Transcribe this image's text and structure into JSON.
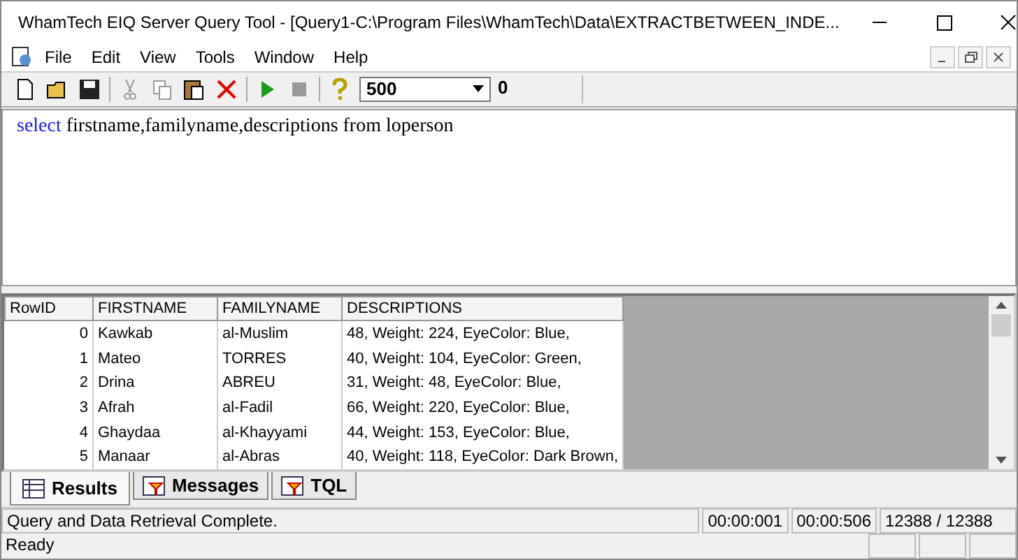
{
  "window": {
    "title": "WhamTech EIQ Server Query Tool - [Query1-C:\\Program Files\\WhamTech\\Data\\EXTRACTBETWEEN_INDE..."
  },
  "menu": [
    "File",
    "Edit",
    "View",
    "Tools",
    "Window",
    "Help"
  ],
  "toolbar": {
    "row_limit": "500",
    "count": "0"
  },
  "query": {
    "keyword": "select",
    "text": "firstname,familyname,descriptions from loperson"
  },
  "table": {
    "columns": [
      "RowID",
      "FIRSTNAME",
      "FAMILYNAME",
      "DESCRIPTIONS"
    ],
    "rows": [
      [
        "0",
        "Kawkab",
        "al-Muslim",
        "48, Weight: 224, EyeColor: Blue,"
      ],
      [
        "1",
        "Mateo",
        "TORRES",
        "40, Weight: 104, EyeColor: Green,"
      ],
      [
        "2",
        "Drina",
        "ABREU",
        "31, Weight: 48, EyeColor: Blue,"
      ],
      [
        "3",
        "Afrah",
        "al-Fadil",
        "66, Weight: 220, EyeColor: Blue,"
      ],
      [
        "4",
        "Ghaydaa",
        "al-Khayyami",
        "44, Weight: 153, EyeColor: Blue,"
      ],
      [
        "5",
        "Manaar",
        "al-Abras",
        "40, Weight: 118, EyeColor: Dark Brown,"
      ]
    ]
  },
  "tabs": [
    {
      "label": "Results",
      "selected": true
    },
    {
      "label": "Messages",
      "selected": false
    },
    {
      "label": "TQL",
      "selected": false
    }
  ],
  "status_bar": {
    "message": "Query and Data Retrieval Complete.",
    "elapsed": "00:00:001",
    "fetch": "00:00:506",
    "rows": "12388 / 12388",
    "state": "Ready"
  }
}
